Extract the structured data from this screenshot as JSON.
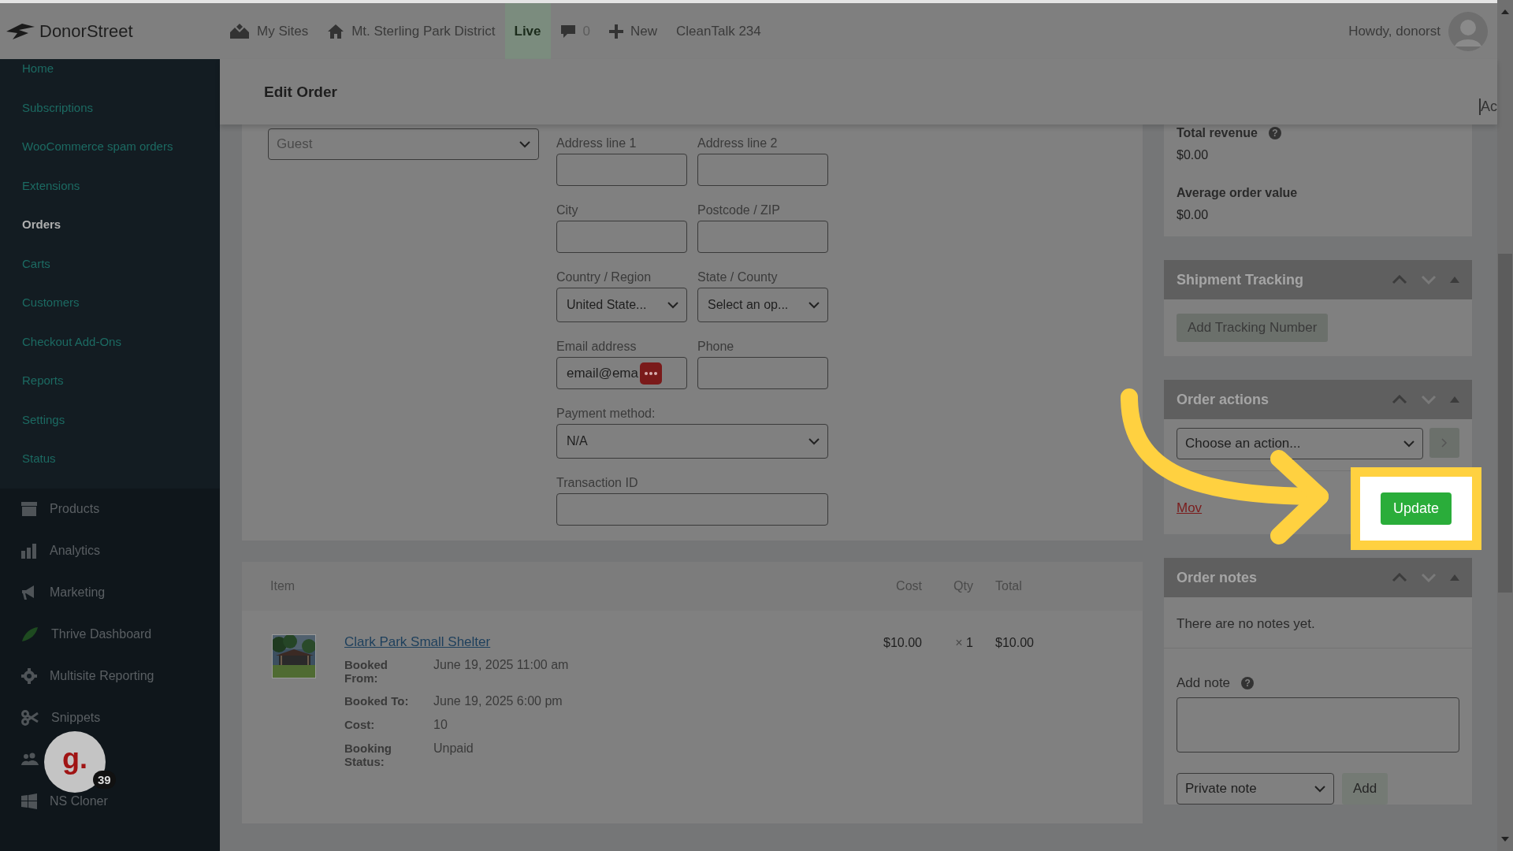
{
  "top_bar": {
    "logo": "DonorStreet",
    "items": [
      {
        "kind": "sites",
        "label": "My Sites"
      },
      {
        "kind": "home",
        "label": "Mt. Sterling Park District"
      },
      {
        "kind": "live",
        "label": "Live"
      },
      {
        "kind": "comments",
        "label": "0"
      },
      {
        "kind": "new",
        "label": "New"
      },
      {
        "kind": "text",
        "label": "CleanTalk 234"
      }
    ],
    "greeting": "Howdy, donorst"
  },
  "sidebar": {
    "submenu": [
      {
        "label": "Home",
        "selected": false
      },
      {
        "label": "Subscriptions",
        "selected": false
      },
      {
        "label": "WooCommerce spam orders",
        "selected": false
      },
      {
        "label": "Extensions",
        "selected": false
      },
      {
        "label": "Orders",
        "selected": true
      },
      {
        "label": "Carts",
        "selected": false
      },
      {
        "label": "Customers",
        "selected": false
      },
      {
        "label": "Checkout Add-Ons",
        "selected": false
      },
      {
        "label": "Reports",
        "selected": false
      },
      {
        "label": "Settings",
        "selected": false
      },
      {
        "label": "Status",
        "selected": false
      }
    ],
    "menu": [
      {
        "kind": "archive",
        "label": "Products"
      },
      {
        "kind": "chart",
        "label": "Analytics"
      },
      {
        "kind": "megaphone",
        "label": "Marketing"
      },
      {
        "kind": "leaf",
        "label": "Thrive Dashboard"
      },
      {
        "kind": "gear",
        "label": "Multisite Reporting"
      },
      {
        "kind": "scissors",
        "label": "Snippets"
      },
      {
        "kind": "users"
      },
      {
        "kind": "windows",
        "label": "NS Cloner"
      }
    ]
  },
  "help_badge": {
    "logo": "g.",
    "count": "39"
  },
  "page_header": {
    "title": "Edit Order",
    "screen_options": "Ac"
  },
  "order_data": {
    "customer": "Guest",
    "fields": [
      {
        "label": "Address line 1",
        "kind": "input"
      },
      {
        "label": "Address line 2",
        "kind": "input"
      },
      {
        "label": "City",
        "kind": "input"
      },
      {
        "label": "Postcode / ZIP",
        "kind": "input"
      },
      {
        "label": "Country / Region",
        "kind": "select",
        "value": "United State..."
      },
      {
        "label": "State / County",
        "kind": "select",
        "value": "Select an op..."
      },
      {
        "label": "Email address",
        "kind": "input",
        "value": "email@ema",
        "autofill_badge": true
      },
      {
        "label": "Phone",
        "kind": "input"
      },
      {
        "label": "Payment method:",
        "kind": "select",
        "value": "N/A",
        "wide": true
      },
      {
        "label": "Transaction ID",
        "kind": "input",
        "wide": true
      }
    ]
  },
  "items": {
    "columns": [
      "Item",
      "Cost",
      "Qty",
      "Total"
    ],
    "rows": [
      {
        "name": "Clark Park Small Shelter",
        "meta": [
          {
            "label": "Booked From:",
            "value": "June 19, 2025 11:00 am"
          },
          {
            "label": "Booked To:",
            "value": "June 19, 2025 6:00 pm"
          },
          {
            "label": "Cost:",
            "value": "10"
          },
          {
            "label": "Booking Status:",
            "value": "Unpaid"
          }
        ],
        "cost": "$10.00",
        "qty_sign": "×",
        "qty": "1",
        "total": "$10.00"
      }
    ]
  },
  "stats": [
    {
      "label": "Total revenue",
      "help": "?",
      "value": "$0.00"
    },
    {
      "label": "Average order value",
      "value": "$0.00"
    }
  ],
  "shipment_tracking": {
    "title": "Shipment Tracking",
    "button": "Add Tracking Number"
  },
  "order_actions": {
    "title": "Order actions",
    "select": "Choose an action...",
    "link": "Mov",
    "button": "Update",
    "highlighted": true
  },
  "order_notes": {
    "title": "Order notes",
    "empty": "There are no notes yet.",
    "add_note_label": "Add note",
    "help": "?",
    "note_type": "Private note",
    "add_button": "Add"
  }
}
